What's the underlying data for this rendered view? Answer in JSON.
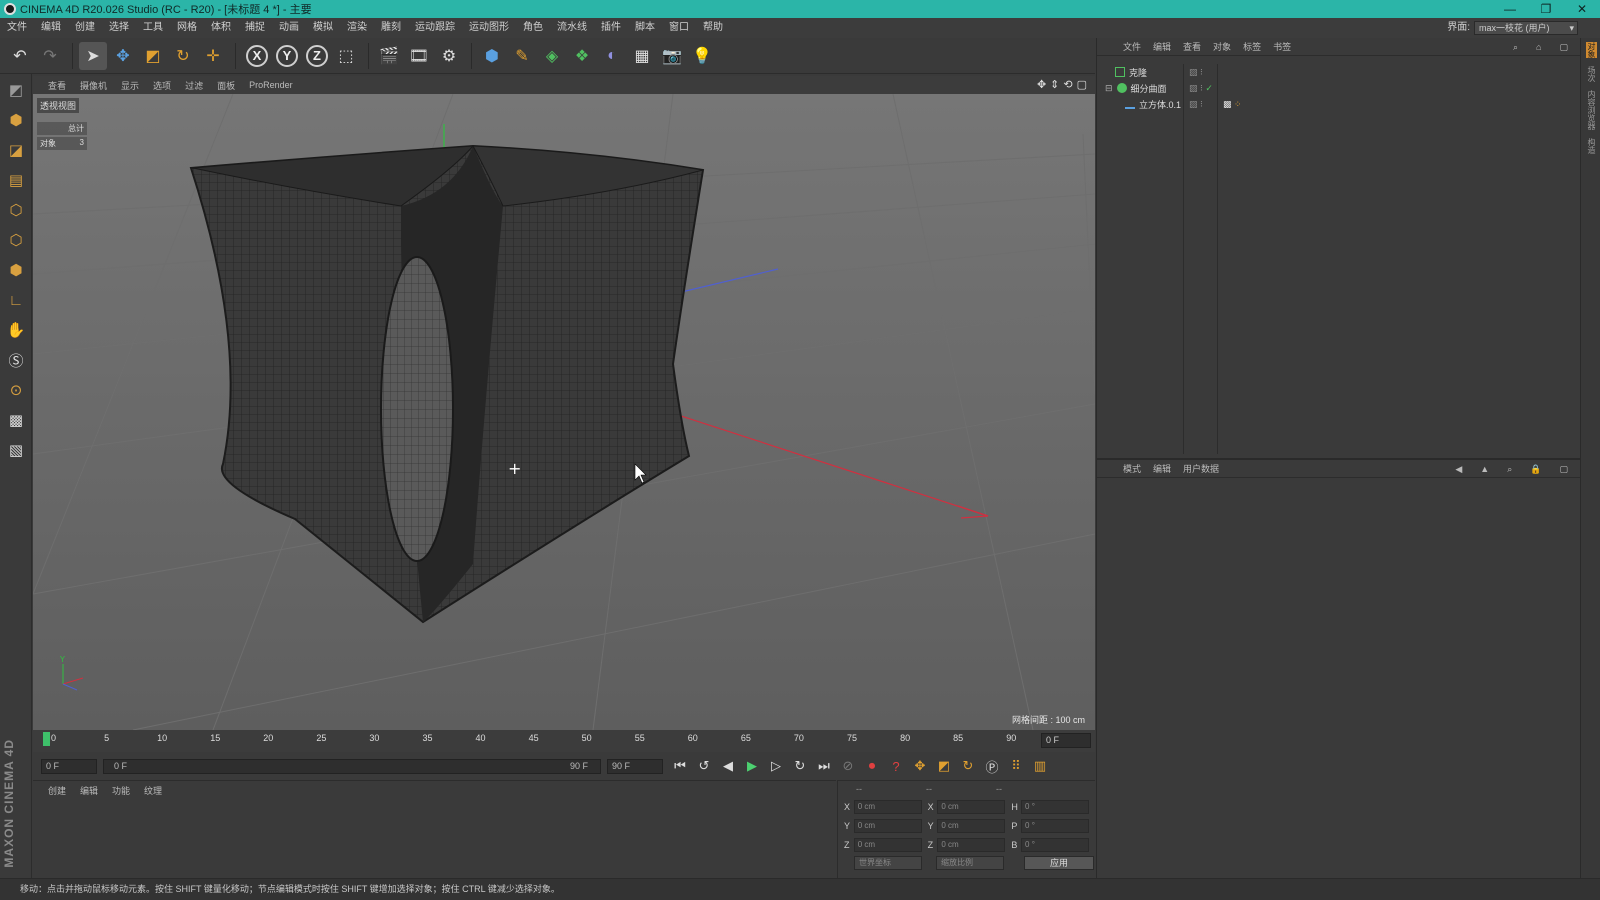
{
  "window": {
    "title": "CINEMA 4D R20.026 Studio (RC - R20) - [未标题 4 *] - 主要",
    "controls": [
      "—",
      "❐",
      "✕"
    ]
  },
  "menubar": {
    "items": [
      "文件",
      "编辑",
      "创建",
      "选择",
      "工具",
      "网格",
      "体积",
      "捕捉",
      "动画",
      "模拟",
      "渲染",
      "雕刻",
      "运动跟踪",
      "运动图形",
      "角色",
      "流水线",
      "插件",
      "脚本",
      "窗口",
      "帮助"
    ],
    "layout_label": "界面:",
    "layout_value": "max一枝花 (用户)"
  },
  "viewport": {
    "menu": [
      "查看",
      "摄像机",
      "显示",
      "选项",
      "过滤",
      "面板",
      "ProRender"
    ],
    "label": "透视视图",
    "stats": [
      {
        "k": "",
        "v": "总计"
      },
      {
        "k": "对象",
        "v": "3"
      }
    ],
    "grid_distance": "网格间距 : 100 cm"
  },
  "timeline": {
    "ticks": [
      "0",
      "5",
      "10",
      "15",
      "20",
      "25",
      "30",
      "35",
      "40",
      "45",
      "50",
      "55",
      "60",
      "65",
      "70",
      "75",
      "80",
      "85",
      "90"
    ],
    "current_frame": "0 F"
  },
  "playbar": {
    "start": "0 F",
    "range_start": "0 F",
    "range_end": "90 F",
    "end": "90 F"
  },
  "material_panel": {
    "menu": [
      "创建",
      "编辑",
      "功能",
      "纹理"
    ]
  },
  "coordinates": {
    "headers": [
      "--",
      "--",
      "--"
    ],
    "rows": [
      {
        "a": "X",
        "av": "0 cm",
        "b": "X",
        "bv": "0 cm",
        "c": "H",
        "cv": "0 °"
      },
      {
        "a": "Y",
        "av": "0 cm",
        "b": "Y",
        "bv": "0 cm",
        "c": "P",
        "cv": "0 °"
      },
      {
        "a": "Z",
        "av": "0 cm",
        "b": "Z",
        "bv": "0 cm",
        "c": "B",
        "cv": "0 °"
      }
    ],
    "mode1": "世界坐标",
    "mode2": "缩放比例",
    "apply": "应用"
  },
  "object_manager": {
    "menu": [
      "文件",
      "编辑",
      "查看",
      "对象",
      "标签",
      "书签"
    ],
    "objects": [
      {
        "name": "克隆",
        "indent": 0
      },
      {
        "name": "细分曲面",
        "indent": 0
      },
      {
        "name": "立方体.0.1",
        "indent": 1
      }
    ]
  },
  "attribute_manager": {
    "menu": [
      "模式",
      "编辑",
      "用户数据"
    ]
  },
  "statusbar": {
    "text": "移动：点击并拖动鼠标移动元素。按住 SHIFT 键量化移动；节点编辑模式时按住 SHIFT 键增加选择对象；按住 CTRL 键减少选择对象。"
  },
  "brand": "MAXON CINEMA 4D",
  "colors": {
    "titlebar": "#2bb5a8",
    "playhead": "#3ec06a",
    "axis_x": "#d03040",
    "axis_y": "#30c040",
    "axis_z": "#4050d0"
  }
}
